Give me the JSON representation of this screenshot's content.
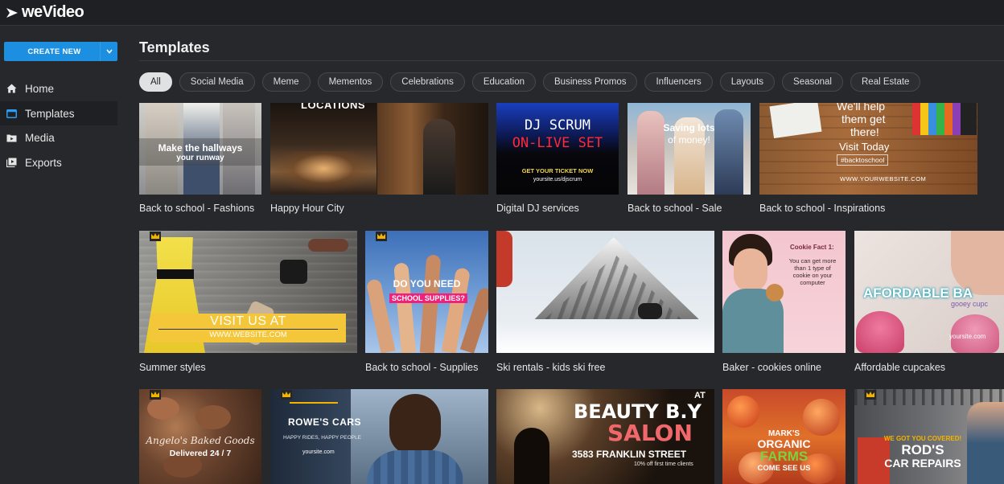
{
  "app": {
    "logo_text": "weVideo"
  },
  "sidebar": {
    "create_label": "CREATE NEW",
    "items": [
      {
        "label": "Home",
        "icon": "home-icon",
        "active": false
      },
      {
        "label": "Templates",
        "icon": "templates-icon",
        "active": true
      },
      {
        "label": "Media",
        "icon": "media-icon",
        "active": false
      },
      {
        "label": "Exports",
        "icon": "exports-icon",
        "active": false
      }
    ]
  },
  "main": {
    "title": "Templates",
    "categories": [
      "All",
      "Social Media",
      "Meme",
      "Mementos",
      "Celebrations",
      "Education",
      "Business Promos",
      "Influencers",
      "Layouts",
      "Seasonal",
      "Real Estate"
    ],
    "active_category": "All"
  },
  "templates": {
    "row1": [
      {
        "caption": "Back to school - Fashions",
        "overlay": [
          "Make the hallways",
          "your runway"
        ]
      },
      {
        "caption": "Happy Hour City",
        "overlay": [
          "LOCATIONS"
        ]
      },
      {
        "caption": "Digital DJ services",
        "overlay": [
          "DJ SCRUM",
          "ON-LIVE SET",
          "GET YOUR TICKET NOW",
          "yoursite.us/djscrum"
        ]
      },
      {
        "caption": "Back to school - Sale",
        "overlay": [
          "Saving lots",
          "of money!"
        ]
      },
      {
        "caption": "Back to school - Inspirations",
        "overlay": [
          "We'll help",
          "them get",
          "there!",
          "Visit Today",
          "#backtoschool",
          "WWW.YOURWEBSITE.COM"
        ]
      }
    ],
    "row2": [
      {
        "caption": "Summer styles",
        "overlay": [
          "VISIT US AT",
          "WWW.WEBSITE.COM"
        ]
      },
      {
        "caption": "Back to school - Supplies",
        "overlay": [
          "DO YOU NEED",
          "SCHOOL SUPPLIES?"
        ]
      },
      {
        "caption": "Ski rentals - kids ski free",
        "overlay": []
      },
      {
        "caption": "Baker - cookies online",
        "overlay": [
          "Cookie Fact 1:",
          "You can get more",
          "than 1 type of",
          "cookie on your",
          "computer"
        ]
      },
      {
        "caption": "Affordable cupcakes",
        "overlay": [
          "AFORDABLE BA",
          "gooey cupc",
          "yoursite.com"
        ]
      }
    ],
    "row3": [
      {
        "caption": "",
        "overlay": [
          "Angelo's Baked Goods",
          "Delivered 24 / 7"
        ]
      },
      {
        "caption": "",
        "overlay": [
          "ROWE'S CARS",
          "HAPPY RIDES, HAPPY PEOPLE",
          "yoursite.com"
        ]
      },
      {
        "caption": "",
        "overlay": [
          "AT",
          "BEAUTY B.Y",
          "SALON",
          "3583  FRANKLIN STREET",
          "10% off first time clients"
        ]
      },
      {
        "caption": "",
        "overlay": [
          "MARK'S",
          "ORGANIC",
          "FARMS",
          "COME SEE US"
        ]
      },
      {
        "caption": "",
        "overlay": [
          "WE GOT YOU COVERED!",
          "ROD'S",
          "CAR REPAIRS"
        ]
      }
    ]
  },
  "colors": {
    "accent": "#1d8fe0",
    "background": "#26282b",
    "premium_crown": "#f2b400",
    "dj_red": "#ff2a36",
    "salon_pink": "#f0686c",
    "farms_green": "#7fd13b"
  }
}
